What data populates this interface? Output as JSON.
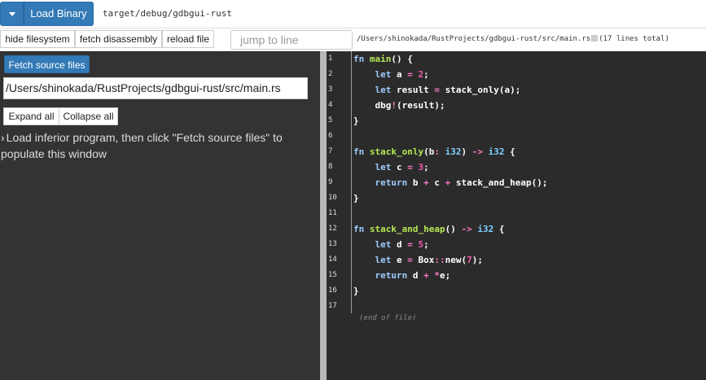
{
  "header": {
    "load_binary_label": "Load Binary",
    "binary_path": "target/debug/gdbgui-rust"
  },
  "toolbar": {
    "hide_filesystem": "hide filesystem",
    "fetch_disassembly": "fetch disassembly",
    "reload_file": "reload file",
    "jump_placeholder": "jump to line",
    "file_path": "/Users/shinokada/RustProjects/gdbgui-rust/src/main.rs",
    "line_count": "(17 lines total)"
  },
  "sidebar": {
    "fetch_source_files": "Fetch source files",
    "source_path": "/Users/shinokada/RustProjects/gdbgui-rust/src/main.rs",
    "expand_all": "Expand all",
    "collapse_all": "Collapse all",
    "message": "Load inferior program, then click \"Fetch source files\" to populate this window"
  },
  "code": {
    "line_numbers": [
      "1",
      "2",
      "3",
      "4",
      "5",
      "6",
      "7",
      "8",
      "9",
      "10",
      "11",
      "12",
      "13",
      "14",
      "15",
      "16",
      "17"
    ],
    "end_of_file": "(end of file)"
  },
  "colors": {
    "accent": "#337ab7",
    "sidebar_bg": "#333333",
    "editor_bg": "#2b2b2b",
    "splitter": "#b7b7b7"
  }
}
